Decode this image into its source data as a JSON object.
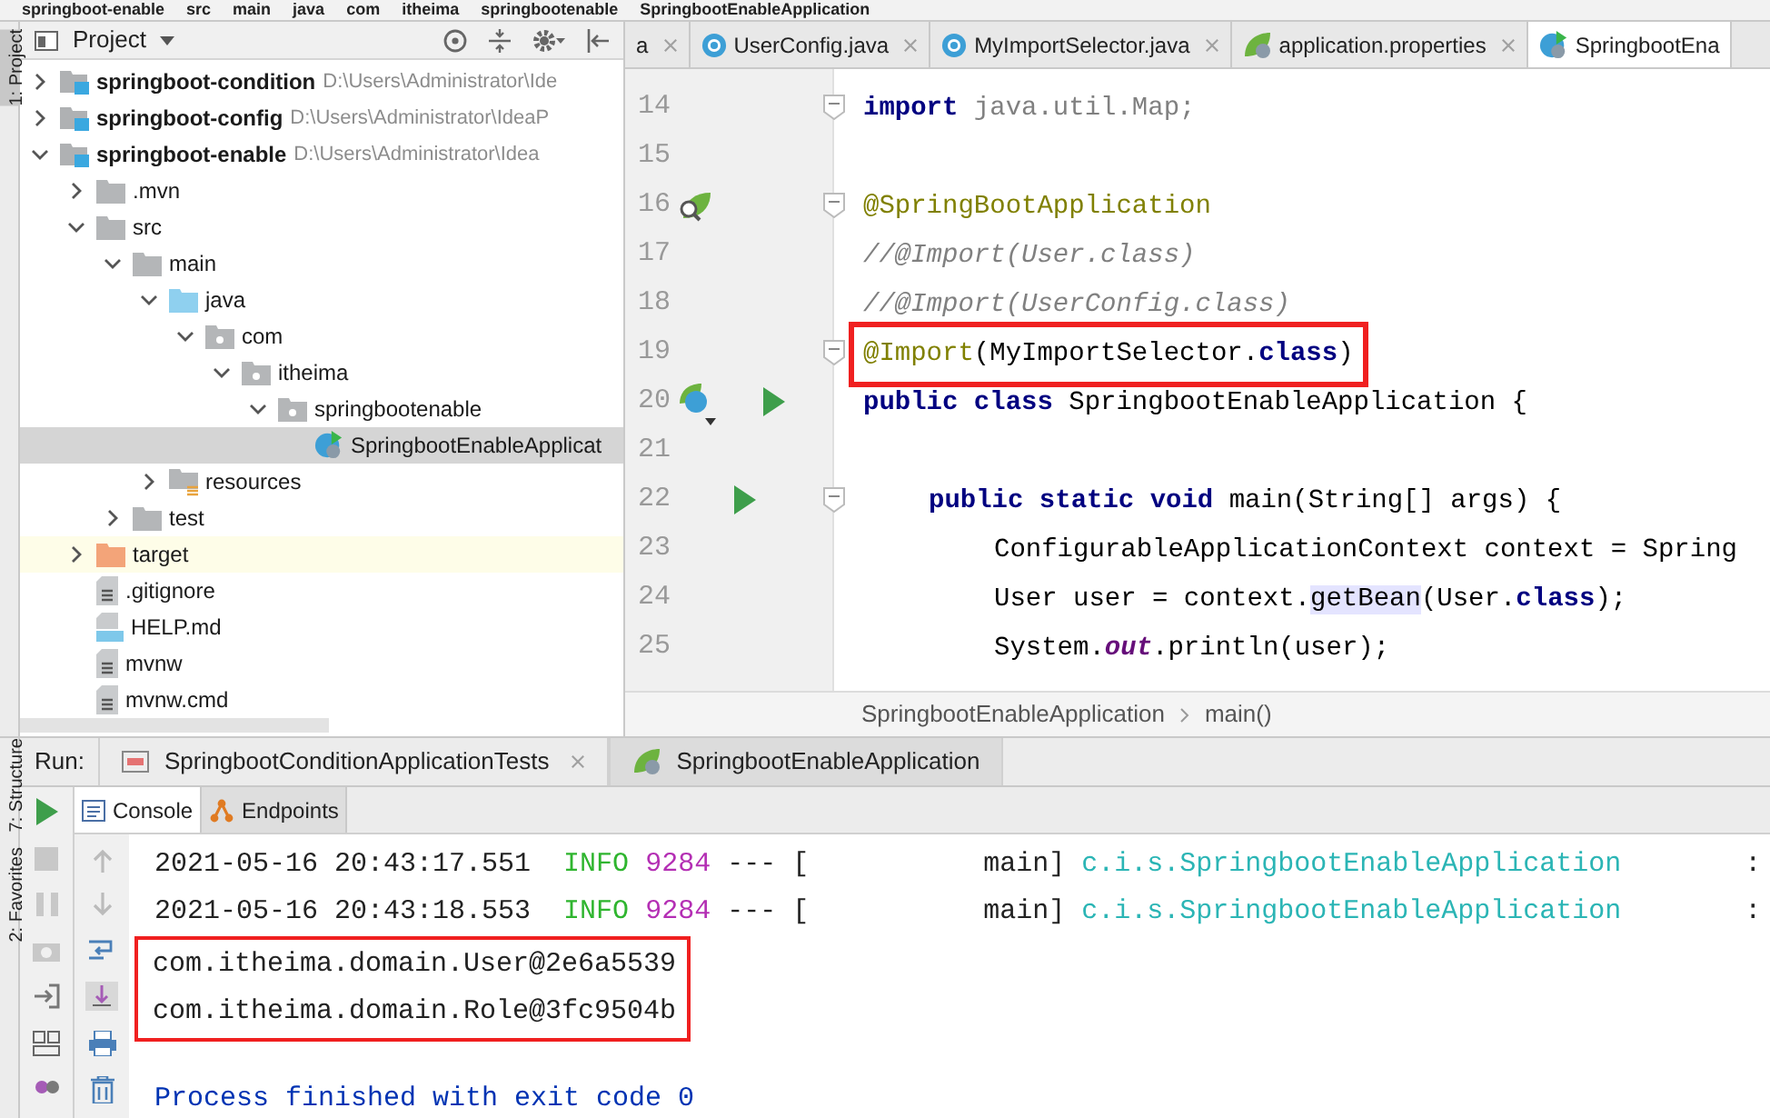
{
  "navigation_bar": {
    "items": [
      "springboot-enable",
      "src",
      "main",
      "java",
      "com",
      "itheima",
      "springbootenable",
      "SpringbootEnableApplication"
    ]
  },
  "left_strip": {
    "top": [
      {
        "label": "1: Project",
        "selected": true
      }
    ],
    "bottom": [
      {
        "label": "7: Structure",
        "selected": false
      },
      {
        "label": "2: Favorites",
        "selected": false
      }
    ]
  },
  "project_panel": {
    "title": "Project",
    "tree": [
      {
        "name": "springboot-condition",
        "path": "D:\\Users\\Administrator\\Ide",
        "kind": "module",
        "expanded": false,
        "selected": false
      },
      {
        "name": "springboot-config",
        "path": "D:\\Users\\Administrator\\IdeaP",
        "kind": "module",
        "expanded": false,
        "selected": false
      },
      {
        "name": "springboot-enable",
        "path": "D:\\Users\\Administrator\\Idea",
        "kind": "module",
        "expanded": true,
        "selected": false,
        "children": [
          {
            "name": ".mvn",
            "kind": "folder",
            "expanded": false,
            "selected": false
          },
          {
            "name": "src",
            "kind": "folder",
            "expanded": true,
            "selected": false,
            "children": [
              {
                "name": "main",
                "kind": "folder",
                "expanded": true,
                "selected": false,
                "children": [
                  {
                    "name": "java",
                    "kind": "source",
                    "expanded": true,
                    "selected": false,
                    "children": [
                      {
                        "name": "com",
                        "kind": "package",
                        "expanded": true,
                        "selected": false,
                        "children": [
                          {
                            "name": "itheima",
                            "kind": "package",
                            "expanded": true,
                            "selected": false,
                            "children": [
                              {
                                "name": "springbootenable",
                                "kind": "package",
                                "expanded": true,
                                "selected": false,
                                "children": [
                                  {
                                    "name": "SpringbootEnableApplicat",
                                    "kind": "spring-class",
                                    "selected": true
                                  }
                                ]
                              }
                            ]
                          }
                        ]
                      }
                    ]
                  },
                  {
                    "name": "resources",
                    "kind": "resources",
                    "expanded": false,
                    "selected": false
                  }
                ]
              },
              {
                "name": "test",
                "kind": "folder",
                "expanded": false,
                "selected": false
              }
            ]
          },
          {
            "name": "target",
            "kind": "excluded",
            "expanded": false,
            "selected": false
          },
          {
            "name": ".gitignore",
            "kind": "file",
            "selected": false
          },
          {
            "name": "HELP.md",
            "kind": "markdown",
            "selected": false
          },
          {
            "name": "mvnw",
            "kind": "file",
            "selected": false
          },
          {
            "name": "mvnw.cmd",
            "kind": "file",
            "selected": false
          }
        ]
      }
    ]
  },
  "editor": {
    "tabs": [
      {
        "label": "a",
        "kind": "none",
        "selected": false
      },
      {
        "label": "UserConfig.java",
        "kind": "class",
        "selected": false
      },
      {
        "label": "MyImportSelector.java",
        "kind": "class",
        "selected": false
      },
      {
        "label": "application.properties",
        "kind": "spring",
        "selected": false
      },
      {
        "label": "SpringbootEna",
        "kind": "spring-class",
        "selected": true
      }
    ],
    "lines": [
      {
        "number": "14",
        "kind": "plain",
        "fold": true,
        "boxed": false,
        "tokens": [
          {
            "kind": "kw",
            "text": "import"
          },
          {
            "kind": "dim",
            "text": " java.util.Map;"
          }
        ]
      },
      {
        "number": "15",
        "kind": "plain",
        "fold": false,
        "boxed": false
      },
      {
        "number": "16",
        "kind": "bean",
        "fold": true,
        "boxed": false,
        "tokens": [
          {
            "kind": "ann",
            "text": "@SpringBootApplication"
          }
        ]
      },
      {
        "number": "17",
        "kind": "plain",
        "fold": false,
        "boxed": false,
        "tokens": [
          {
            "kind": "cmt",
            "text": "//@Import(User.class)"
          }
        ]
      },
      {
        "number": "18",
        "kind": "plain",
        "fold": false,
        "boxed": false,
        "tokens": [
          {
            "kind": "cmt",
            "text": "//@Import(UserConfig.class)"
          }
        ]
      },
      {
        "number": "19",
        "kind": "plain",
        "fold": true,
        "boxed": true,
        "tokens": [
          {
            "kind": "ann",
            "text": "@Import"
          },
          {
            "kind": "plain",
            "text": "(MyImportSelector."
          },
          {
            "kind": "kw",
            "text": "class"
          },
          {
            "kind": "plain",
            "text": ")"
          }
        ]
      },
      {
        "number": "20",
        "kind": "main-class",
        "fold": false,
        "boxed": false,
        "tokens": [
          {
            "kind": "kw",
            "text": "public class "
          },
          {
            "kind": "plain",
            "text": "SpringbootEnableApplication {"
          }
        ]
      },
      {
        "number": "21",
        "kind": "plain",
        "fold": false,
        "boxed": false
      },
      {
        "number": "22",
        "kind": "main-method",
        "fold": true,
        "boxed": false,
        "tokens": [
          {
            "kind": "kw",
            "text": "public static void "
          },
          {
            "kind": "plain",
            "text": "main(String[] args) {"
          }
        ]
      },
      {
        "number": "23",
        "kind": "body",
        "fold": false,
        "boxed": false,
        "tokens": [
          {
            "kind": "plain",
            "text": "ConfigurableApplicationContext context = Spring"
          }
        ]
      },
      {
        "number": "24",
        "kind": "body",
        "fold": false,
        "boxed": false,
        "tokens": [
          {
            "kind": "plain",
            "text": "User user = context."
          },
          {
            "kind": "hl",
            "text": "getBean"
          },
          {
            "kind": "plain",
            "text": "(User."
          },
          {
            "kind": "kw",
            "text": "class"
          },
          {
            "kind": "plain",
            "text": ");"
          }
        ]
      },
      {
        "number": "25",
        "kind": "body",
        "fold": false,
        "boxed": false,
        "tokens": [
          {
            "kind": "plain",
            "text": "System."
          },
          {
            "kind": "field",
            "text": "out"
          },
          {
            "kind": "plain",
            "text": ".println(user);"
          }
        ]
      }
    ],
    "breadcrumb": [
      "SpringbootEnableApplication",
      "main()"
    ]
  },
  "run_panel": {
    "label": "Run:",
    "tabs": [
      {
        "label": "SpringbootConditionApplicationTests",
        "kind": "test",
        "selected": false
      },
      {
        "label": "SpringbootEnableApplication",
        "kind": "spring",
        "selected": true
      }
    ],
    "subtabs": [
      {
        "label": "Console",
        "kind": "console",
        "selected": true
      },
      {
        "label": "Endpoints",
        "kind": "endpoints",
        "selected": false
      }
    ],
    "console": [
      {
        "kind": "log",
        "timestamp": "2021-05-16 20:43:17.551",
        "level": "INFO",
        "pid": "9284",
        "separator": "--- [",
        "thread": "main]",
        "logger": "c.i.s.SpringbootEnableApplication",
        "colon": ":"
      },
      {
        "kind": "log",
        "timestamp": "2021-05-16 20:43:18.553",
        "level": "INFO",
        "pid": "9284",
        "separator": "--- [",
        "thread": "main]",
        "logger": "c.i.s.SpringbootEnableApplication",
        "colon": ":"
      },
      {
        "kind": "output_group",
        "boxed": true,
        "lines": [
          "com.itheima.domain.User@2e6a5539",
          "com.itheima.domain.Role@3fc9504b"
        ]
      },
      {
        "kind": "exit",
        "text": "Process finished with exit code 0"
      }
    ]
  }
}
